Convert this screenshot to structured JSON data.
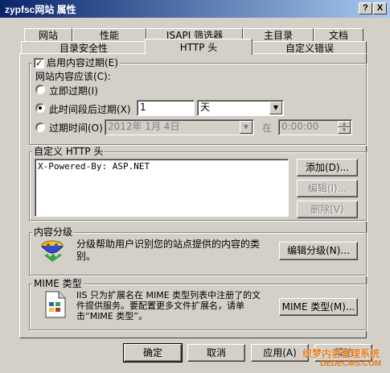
{
  "window": {
    "title": "zypfsc网站 属性",
    "help_btn": "?",
    "close_btn": "X"
  },
  "tabs": {
    "row1": [
      "网站",
      "性能",
      "ISAPI 筛选器",
      "主目录",
      "文档"
    ],
    "row2": [
      "目录安全性",
      "HTTP 头",
      "自定义错误"
    ]
  },
  "expire": {
    "enable_label": "启用内容过期(E)",
    "enabled": true,
    "group_label": "网站内容应该(C):",
    "immediately": "立即过期(I)",
    "after": "此时间段后过期(X)",
    "after_value": "1",
    "after_unit": "天",
    "at": "过期时间(O)",
    "at_date": "2012年 1月 4日",
    "at_word": "在",
    "at_time": "0:00:00",
    "selected": "after"
  },
  "custom_headers": {
    "group_label": "自定义 HTTP 头",
    "items": [
      "X-Powered-By: ASP.NET"
    ],
    "add": "添加(D)...",
    "edit": "编辑(I)...",
    "delete": "删除(V)"
  },
  "ratings": {
    "group_label": "内容分级",
    "description": "分级帮助用户识别您的站点提供的内容的类别。",
    "edit": "编辑分级(N)..."
  },
  "mime": {
    "group_label": "MIME 类型",
    "description": "IIS 只为扩展名在 MIME 类型列表中注册了的文件提供服务。要配置更多文件扩展名，请单击“MIME 类型”。",
    "button": "MIME 类型(M)..."
  },
  "footer": {
    "ok": "确定",
    "cancel": "取消",
    "apply": "应用(A)",
    "help": "帮助"
  },
  "watermark": {
    "line1": "织梦内容管理系统",
    "line2": "DEDECMS.COM"
  }
}
